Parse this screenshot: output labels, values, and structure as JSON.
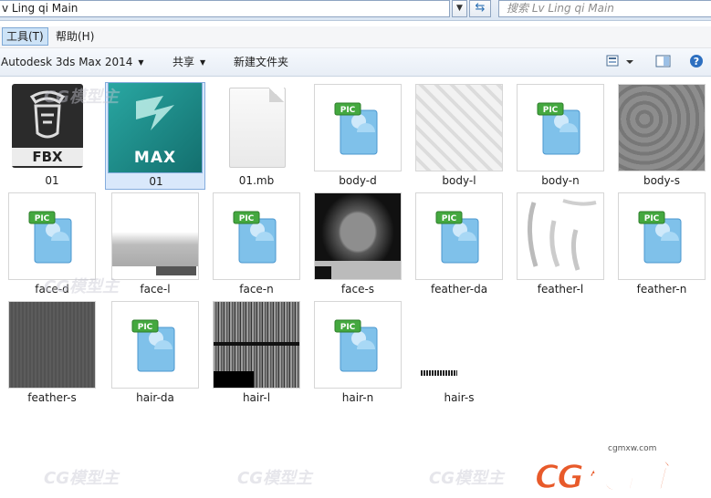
{
  "address": {
    "path": "v Ling qi Main",
    "search_placeholder": "搜索 Lv Ling qi Main"
  },
  "menu": {
    "tools": "工具(T)",
    "help": "帮助(H)"
  },
  "toolbar": {
    "open_with": "Autodesk 3ds Max 2014",
    "share": "共享",
    "new_folder": "新建文件夹"
  },
  "files": [
    {
      "name": "01",
      "kind": "fbx",
      "thumb_text": "FBX"
    },
    {
      "name": "01",
      "kind": "max",
      "thumb_text": "MAX"
    },
    {
      "name": "01.mb",
      "kind": "blank"
    },
    {
      "name": "body-d",
      "kind": "pic",
      "thumb_text": "PIC"
    },
    {
      "name": "body-l",
      "kind": "tex-light"
    },
    {
      "name": "body-n",
      "kind": "pic",
      "thumb_text": "PIC"
    },
    {
      "name": "body-s",
      "kind": "tex-gray"
    },
    {
      "name": "face-d",
      "kind": "pic",
      "thumb_text": "PIC"
    },
    {
      "name": "face-l",
      "kind": "tex-facel"
    },
    {
      "name": "face-n",
      "kind": "pic",
      "thumb_text": "PIC"
    },
    {
      "name": "face-s",
      "kind": "tex-faces"
    },
    {
      "name": "feather-da",
      "kind": "pic",
      "thumb_text": "PIC"
    },
    {
      "name": "feather-l",
      "kind": "tex-feather"
    },
    {
      "name": "feather-n",
      "kind": "pic",
      "thumb_text": "PIC"
    },
    {
      "name": "feather-s",
      "kind": "tex-dark"
    },
    {
      "name": "hair-da",
      "kind": "pic",
      "thumb_text": "PIC"
    },
    {
      "name": "hair-l",
      "kind": "tex-hair"
    },
    {
      "name": "hair-n",
      "kind": "pic",
      "thumb_text": "PIC"
    },
    {
      "name": "hair-s",
      "kind": "tex-hairs"
    }
  ],
  "watermark": {
    "text": "CG模型主",
    "url": "cgmxw.com"
  }
}
